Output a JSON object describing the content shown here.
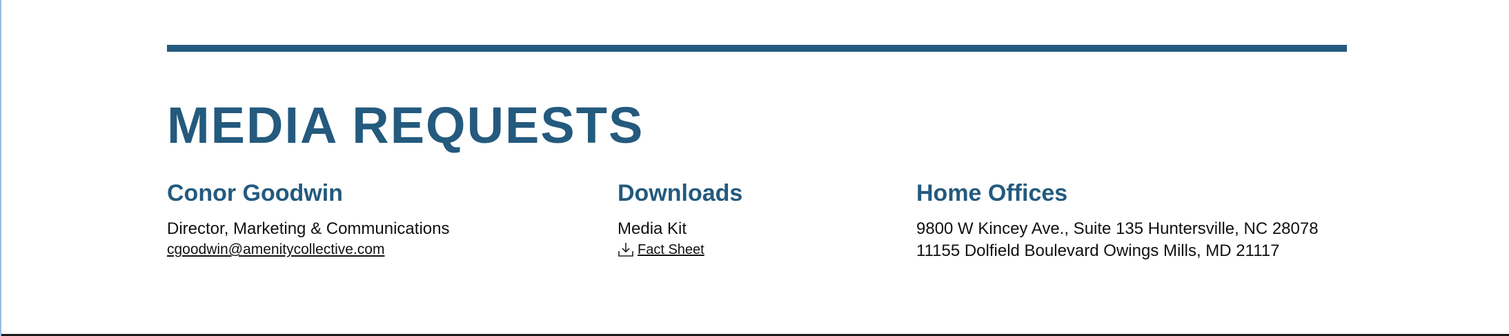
{
  "section": {
    "title": "MEDIA REQUESTS",
    "accent_color": "#245a7e"
  },
  "contact": {
    "name": "Conor Goodwin",
    "role": "Director, Marketing & Communications",
    "email": "cgoodwin@amenitycollective.com"
  },
  "downloads": {
    "heading": "Downloads",
    "media_kit_label": "Media Kit",
    "fact_sheet_link": "Fact Sheet",
    "icon": "download-icon"
  },
  "offices": {
    "heading": "Home Offices",
    "addresses": [
      "9800 W Kincey Ave., Suite 135 Huntersville, NC 28078",
      "11155 Dolfield Boulevard Owings Mills, MD 21117"
    ]
  }
}
